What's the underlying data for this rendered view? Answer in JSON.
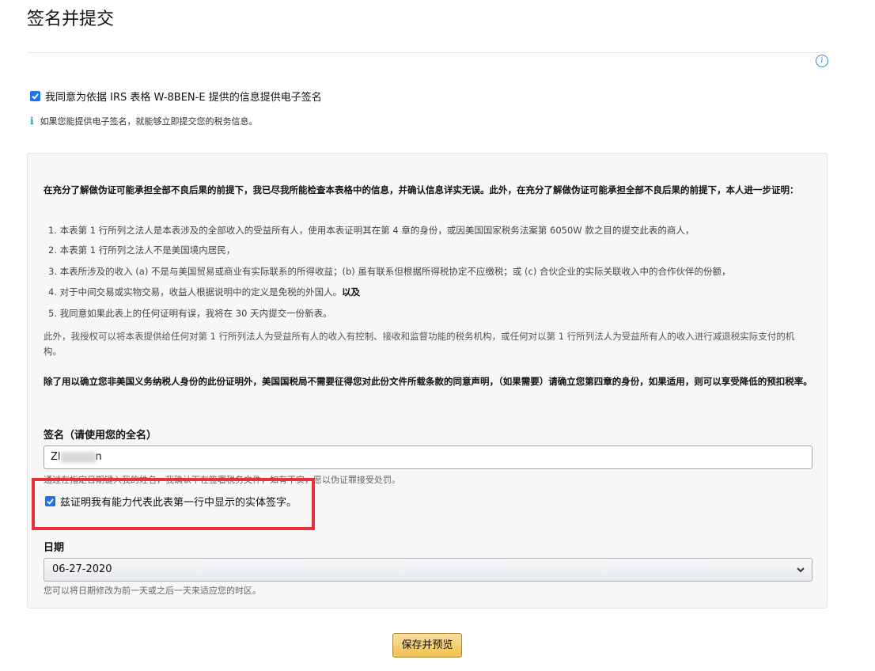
{
  "page": {
    "title": "签名并提交",
    "info_icon": "info-circle-icon"
  },
  "consent": {
    "checked": true,
    "label": "我同意为依据 IRS 表格 W-8BEN-E 提供的信息提供电子签名",
    "hint_icon": "i",
    "hint": "如果您能提供电子签名，就能够立即提交您的税务信息。"
  },
  "certification": {
    "intro": "在充分了解做伪证可能承担全部不良后果的前提下，我已尽我所能检查本表格中的信息，并确认信息详实无误。此外，在充分了解做伪证可能承担全部不良后果的前提下，本人进一步证明：",
    "items": [
      {
        "text": "1. 本表第 1 行所列之法人是本表涉及的全部收入的受益所有人，使用本表证明其在第 4 章的身份，或因美国国家税务法案第 6050W 款之目的提交此表的商人，",
        "suffix": ""
      },
      {
        "text": "2. 本表第 1 行所列之法人不是美国境内居民，",
        "suffix": ""
      },
      {
        "text": "3. 本表所涉及的收入 (a) 不是与美国贸易或商业有实际联系的所得收益；(b) 虽有联系但根据所得税协定不应缴税；或 (c) 合伙企业的实际关联收入中的合作伙伴的份额，",
        "suffix": ""
      },
      {
        "text": "4. 对于中间交易或实物交易，收益人根据说明中的定义是免税的外国人。",
        "suffix": "以及"
      },
      {
        "text": "5. 我同意如果此表上的任何证明有误，我将在 30 天内提交一份新表。",
        "suffix": ""
      }
    ],
    "authorization": "此外，我授权可以将本表提供给任何对第 1 行所列法人为受益所有人的收入有控制、接收和监督功能的税务机构，或任何对以第 1 行所列法人为受益所有人的收入进行减退税实际支付的机构。",
    "irs_note": "除了用以确立您非美国义务纳税人身份的此份证明外，美国国税局不需要征得您对此份文件所载条款的同意声明，（如果需要）请确立您第四章的身份，如果适用，则可以享受降低的预扣税率。"
  },
  "signature": {
    "label": "签名（请使用您的全名）",
    "value_start": "Zl",
    "value_end": "n",
    "note": "通过在指定日期键入我的姓名，我确认下在签署税务文件，如有不实，愿以伪证罪接受处罚。"
  },
  "capacity": {
    "checked": true,
    "label": "兹证明我有能力代表此表第一行中显示的实体签字。"
  },
  "date": {
    "label": "日期",
    "selected": "06-27-2020",
    "note": "您可以将日期修改为前一天或之后一天来适应您的时区。"
  },
  "actions": {
    "save_preview": "保存并预览"
  },
  "colors": {
    "checkbox": "#1a73e8",
    "highlight": "#e8323b",
    "button": "#f0c14b",
    "info": "#2f8fbd"
  }
}
